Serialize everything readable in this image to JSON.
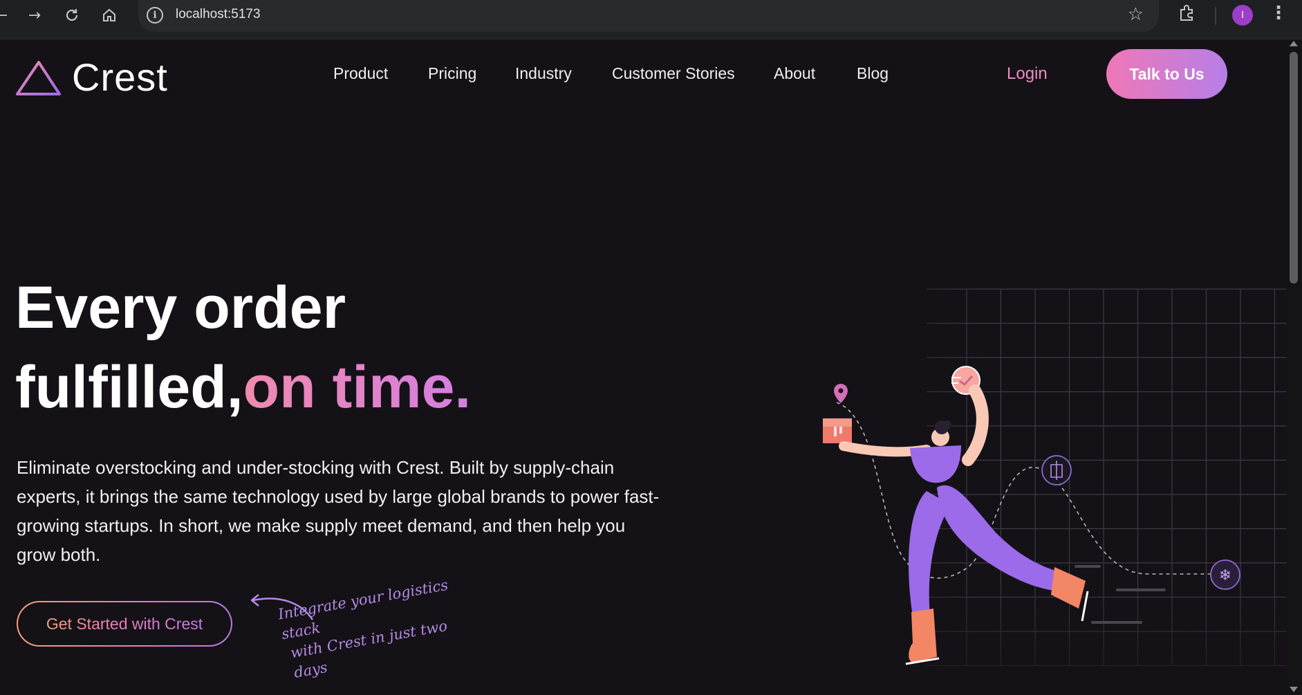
{
  "browser": {
    "url": "localhost:5173",
    "profile_initial": "I"
  },
  "site": {
    "brand": "Crest",
    "nav": [
      "Product",
      "Pricing",
      "Industry",
      "Customer Stories",
      "About",
      "Blog"
    ],
    "login": "Login",
    "cta_header": "Talk to Us"
  },
  "hero": {
    "title_line1": "Every order",
    "title_line2_prefix": "fulfilled,",
    "title_line2_accent": "on time.",
    "body": "Eliminate overstocking and under-stocking with Crest. Built by supply-chain experts, it brings the same technology used by large global brands to power fast-growing startups. In short, we make supply meet demand, and then help you grow both.",
    "cta": "Get Started with Crest",
    "annotation_line1": "Integrate your logistics stack",
    "annotation_line2": "with Crest in just two days"
  },
  "colors": {
    "background": "#151217",
    "accent_pink": "#ee78b6",
    "accent_purple": "#b77ee8",
    "login": "#ec8cc4"
  }
}
